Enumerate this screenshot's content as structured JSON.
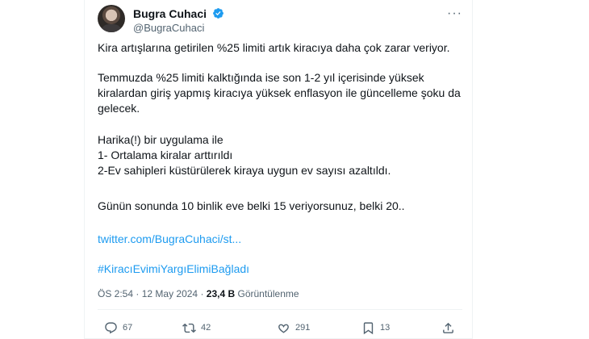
{
  "tweet": {
    "author": {
      "name": "Bugra Cuhaci",
      "handle": "@BugraCuhaci"
    },
    "paragraph1": "Kira artışlarına getirilen %25 limiti artık kiracıya daha çok zarar veriyor.",
    "paragraph2": "Temmuzda %25 limiti kalktığında ise son 1-2 yıl içerisinde yüksek kiralardan giriş yapmış kiracıya yüksek enflasyon ile güncelleme şoku da gelecek.",
    "paragraph3_lines": [
      "Harika(!) bir uygulama ile",
      "1- Ortalama kiralar arttırıldı",
      "2-Ev sahipleri küstürülerek kiraya uygun ev sayısı azaltıldı."
    ],
    "paragraph4": "Günün sonunda 10 binlik eve belki 15 veriyorsunuz, belki 20..",
    "link": "twitter.com/BugraCuhaci/st...",
    "hashtag": "#KiracıEvimiYargıElimiBağladı",
    "time": "ÖS 2:54",
    "date": "12 May 2024",
    "separator": "·",
    "views_count": "23,4 B",
    "views_label": "Görüntülenme"
  },
  "actions": {
    "replies": "67",
    "retweets": "42",
    "likes": "291",
    "bookmarks": "13"
  },
  "colors": {
    "accent": "#1d9bf0",
    "muted": "#536471",
    "text": "#0f1419"
  }
}
